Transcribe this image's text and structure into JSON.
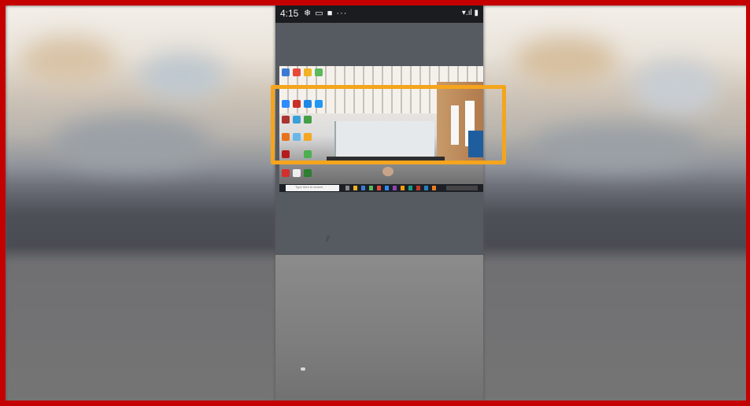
{
  "status_bar": {
    "time": "4:15",
    "left_icons": "❄ ▭ ■ ···",
    "right_icons": "▾.ıl ▮"
  },
  "shared_screen": {
    "taskbar_search_placeholder": "Type here to search"
  },
  "colors": {
    "border": "#c40000",
    "highlight": "#f4a51d",
    "status_bar": "#1b1c1f",
    "taskbar": "#1c2026"
  },
  "icons": [
    "snowflake-icon",
    "cast-icon",
    "camera-icon",
    "more-dots-icon",
    "wifi-icon",
    "signal-icon",
    "battery-icon"
  ]
}
